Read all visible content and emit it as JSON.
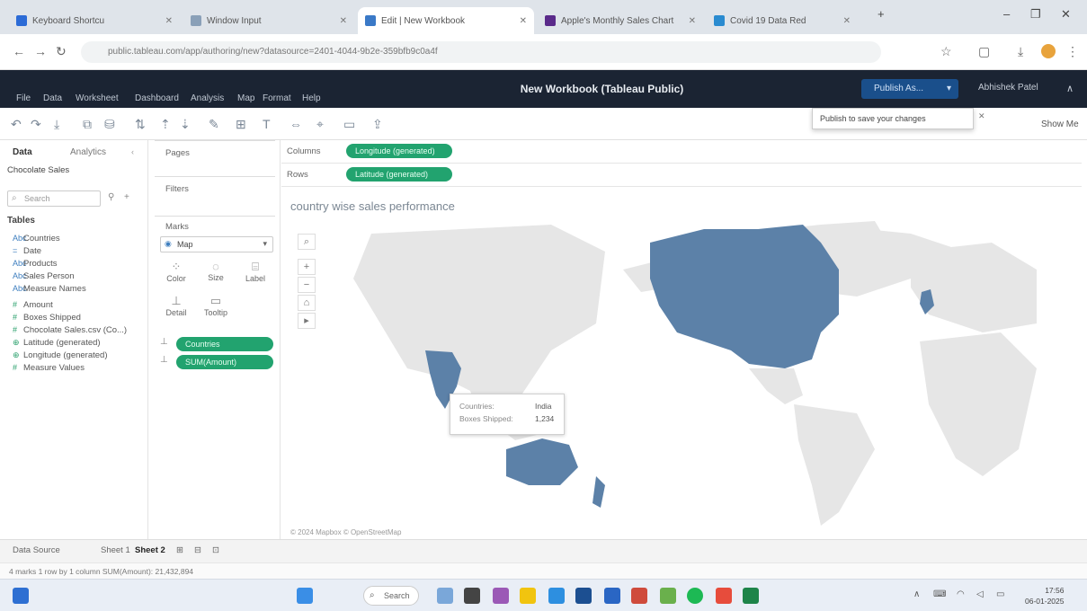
{
  "browser": {
    "tabs": [
      {
        "label": "Keyboard Shortcu",
        "color": "#2c6bd6"
      },
      {
        "label": "Window Input",
        "color": "#8aa0b8"
      },
      {
        "label": "Edit | New Workbook",
        "color": "#3a79c7"
      },
      {
        "label": "Apple's Monthly Sales Chart",
        "color": "#5a2a8a"
      },
      {
        "label": "Covid 19 Data Red",
        "color": "#2a8bd0"
      }
    ],
    "new_tab": "+",
    "url": "public.tableau.com/app/authoring/new?datasource=2401-4044-9b2e-359bfb9c0a4f"
  },
  "tableau": {
    "menu": [
      "File",
      "Data",
      "Worksheet",
      "Dashboard",
      "Analysis",
      "Map",
      "Format",
      "Help"
    ],
    "workbook_title": "New Workbook (Tableau Public)",
    "publish_label": "Publish As...",
    "account_label": "Abhishek Patel",
    "publish_tooltip": "Publish to save your changes",
    "show_me": "Show Me"
  },
  "data_pane": {
    "tabs": [
      "Data",
      "Analytics"
    ],
    "datasource": "Chocolate Sales",
    "search_placeholder": "Search",
    "tables_label": "Tables",
    "fields": [
      {
        "icon": "Abc",
        "name": "Countries"
      },
      {
        "icon": "=",
        "name": "Date"
      },
      {
        "icon": "Abc",
        "name": "Products"
      },
      {
        "icon": "Abc",
        "name": "Sales Person"
      },
      {
        "icon": "Abc",
        "name": "Measure Names"
      },
      {
        "icon": "#",
        "name": "Amount"
      },
      {
        "icon": "#",
        "name": "Boxes Shipped"
      },
      {
        "icon": "#",
        "name": "Chocolate Sales.csv (Co...)"
      },
      {
        "icon": "⊕",
        "name": "Latitude (generated)"
      },
      {
        "icon": "⊕",
        "name": "Longitude (generated)"
      },
      {
        "icon": "#",
        "name": "Measure Values"
      }
    ]
  },
  "cards": {
    "pages": "Pages",
    "filters": "Filters",
    "marks": "Marks",
    "mark_type": "Map",
    "mark_buttons": [
      "Color",
      "Size",
      "Label",
      "Detail",
      "Tooltip"
    ],
    "mark_pills": [
      "Countries",
      "SUM(Amount)"
    ]
  },
  "shelves": {
    "columns_label": "Columns",
    "rows_label": "Rows",
    "columns_pill": "Longitude (generated)",
    "rows_pill": "Latitude (generated)"
  },
  "viz": {
    "title": "country wise sales performance",
    "attribution": "© 2024 Mapbox © OpenStreetMap",
    "highlight_color": "#5c81a8",
    "land_color": "#e6e6e6",
    "tooltip": {
      "row1_label": "Countries:",
      "row1_value": "India",
      "row2_label": "Boxes Shipped:",
      "row2_value": "1,234"
    }
  },
  "bottom": {
    "tabs": [
      "Data Source",
      "Sheet 1",
      "Sheet 2"
    ],
    "status": "4 marks  1 row by 1 column  SUM(Amount): 21,432,894"
  },
  "taskbar": {
    "search": "Search",
    "clock_time": "17:56",
    "clock_date": "06-01-2025"
  }
}
